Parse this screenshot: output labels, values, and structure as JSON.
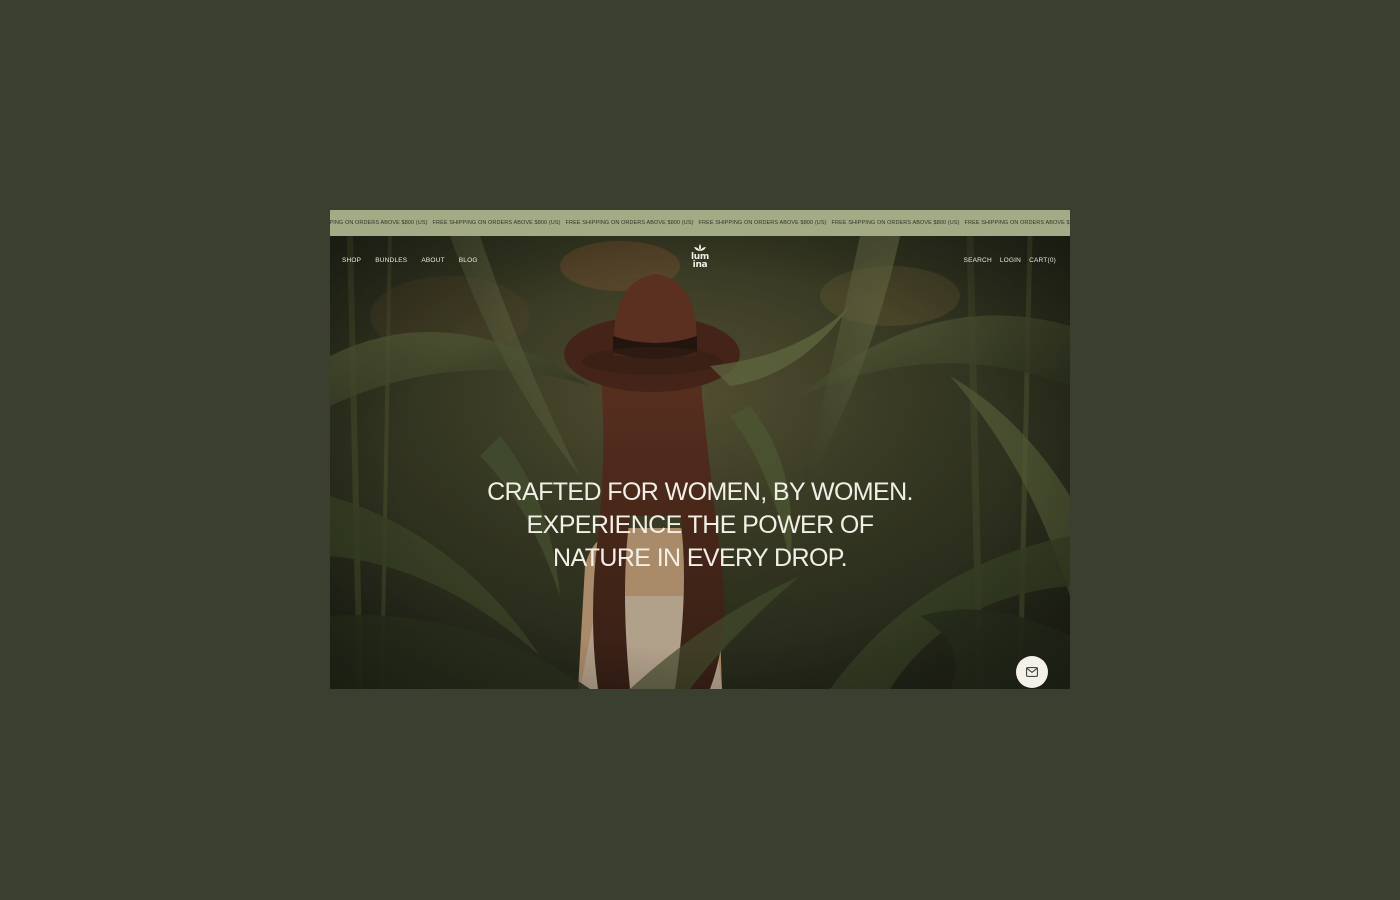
{
  "announcement": {
    "items": [
      "hipping on orders above $800 (US)",
      "Free shipping on orders above $800 (US)",
      "Free shipping on orders above $800 (US)",
      "Free shipping on orders above $800 (US)",
      "Free shipping on orders above $800 (US)",
      "Free shipping on orders above $8"
    ]
  },
  "nav": {
    "left": [
      "SHOP",
      "BUNDLES",
      "ABOUT",
      "BLOG"
    ],
    "right": [
      "SEARCH",
      "LOGIN",
      "CART(0)"
    ]
  },
  "logo": {
    "line1": "lum",
    "line2": "ina",
    "icon": "leaf-icon"
  },
  "hero": {
    "headline": [
      "CRAFTED FOR WOMEN, BY WOMEN.",
      "EXPERIENCE THE POWER OF",
      "NATURE IN EVERY DROP."
    ]
  },
  "contact": {
    "icon": "mail-icon"
  },
  "colors": {
    "page_bg": "#3a3f30",
    "announce_bg": "#a2ab86",
    "text_light": "#f2efe6"
  }
}
